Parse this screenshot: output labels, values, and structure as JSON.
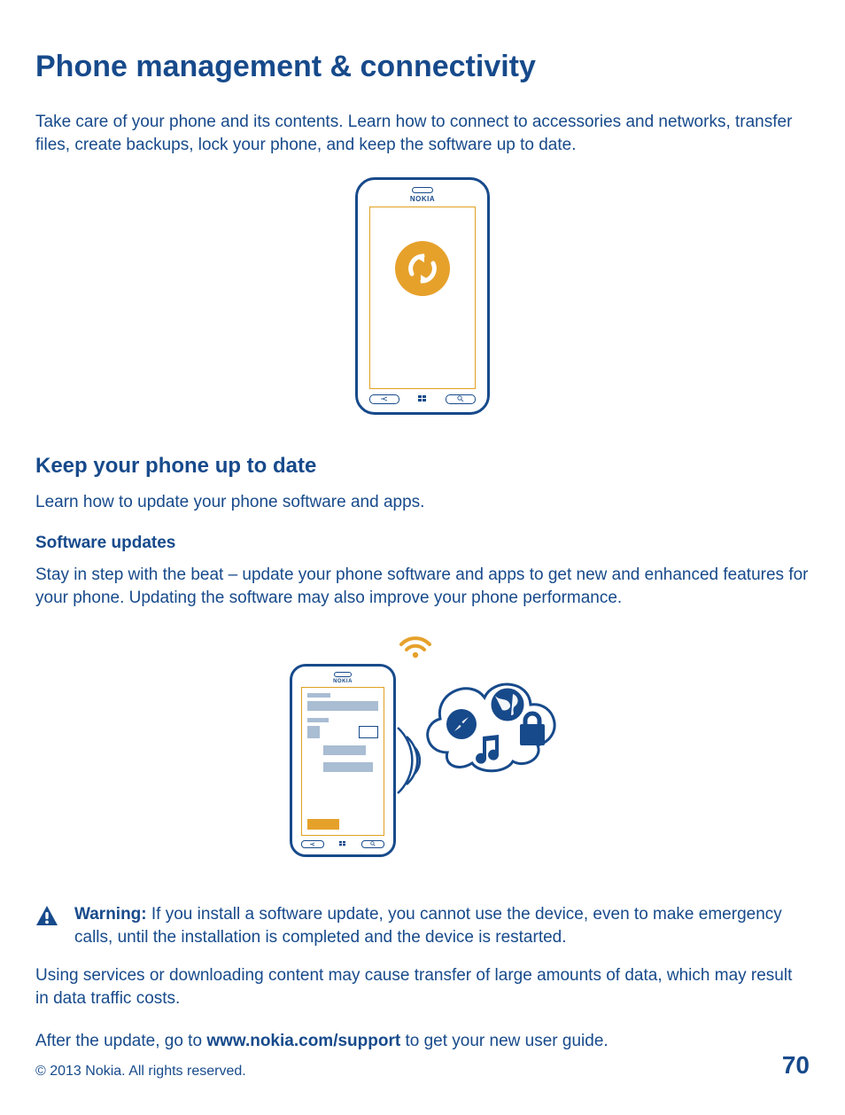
{
  "title": "Phone management & connectivity",
  "intro": "Take care of your phone and its contents. Learn how to connect to accessories and networks, transfer files, create backups, lock your phone, and keep the software up to date.",
  "phone_brand": "NOKIA",
  "section1": {
    "heading": "Keep your phone up to date",
    "text": "Learn how to update your phone software and apps."
  },
  "section2": {
    "heading": "Software updates",
    "text": "Stay in step with the beat – update your phone software and apps to get new and enhanced features for your phone. Updating the software may also improve your phone performance."
  },
  "warning": {
    "label": "Warning:",
    "text": " If you install a software update, you cannot use the device, even to make emergency calls, until the installation is completed and the device is restarted."
  },
  "para_data": "Using services or downloading content may cause transfer of large amounts of data, which may result in data traffic costs.",
  "after_update_pre": "After the update, go to ",
  "after_update_link": "www.nokia.com/support",
  "after_update_post": " to get your new user guide.",
  "copyright": "© 2013 Nokia. All rights reserved.",
  "page_number": "70"
}
